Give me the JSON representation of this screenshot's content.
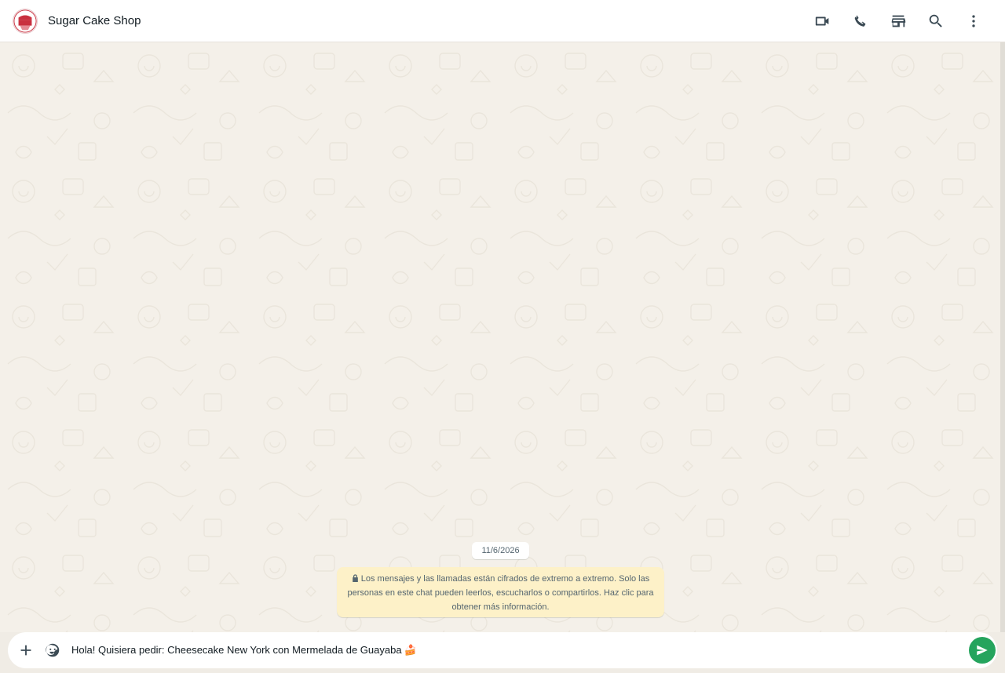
{
  "header": {
    "contact_name": "Sugar Cake Shop",
    "avatar_text_top": "SUGAR",
    "avatar_text_bottom": "CAKE",
    "actions": [
      {
        "icon": "video-call-icon"
      },
      {
        "icon": "phone-icon"
      },
      {
        "icon": "store-icon"
      },
      {
        "icon": "search-icon"
      },
      {
        "icon": "more-vertical-icon"
      }
    ]
  },
  "chat": {
    "date_chip": "11/6/2026",
    "encryption_notice": "Los mensajes y las llamadas están cifrados de extremo a extremo. Solo las personas en este chat pueden leerlos, escucharlos o compartirlos. Haz clic para obtener más información."
  },
  "composer": {
    "message_value": "Hola! Quisiera pedir: Cheesecake New York con Mermelada de Guayaba",
    "message_emoji": "🍰"
  },
  "colors": {
    "header_bg": "#ffffff",
    "chat_bg": "#f4f0e9",
    "encryption_bg": "#fdf1c8",
    "send_button": "#25a45d",
    "icon": "#3b4a54"
  }
}
